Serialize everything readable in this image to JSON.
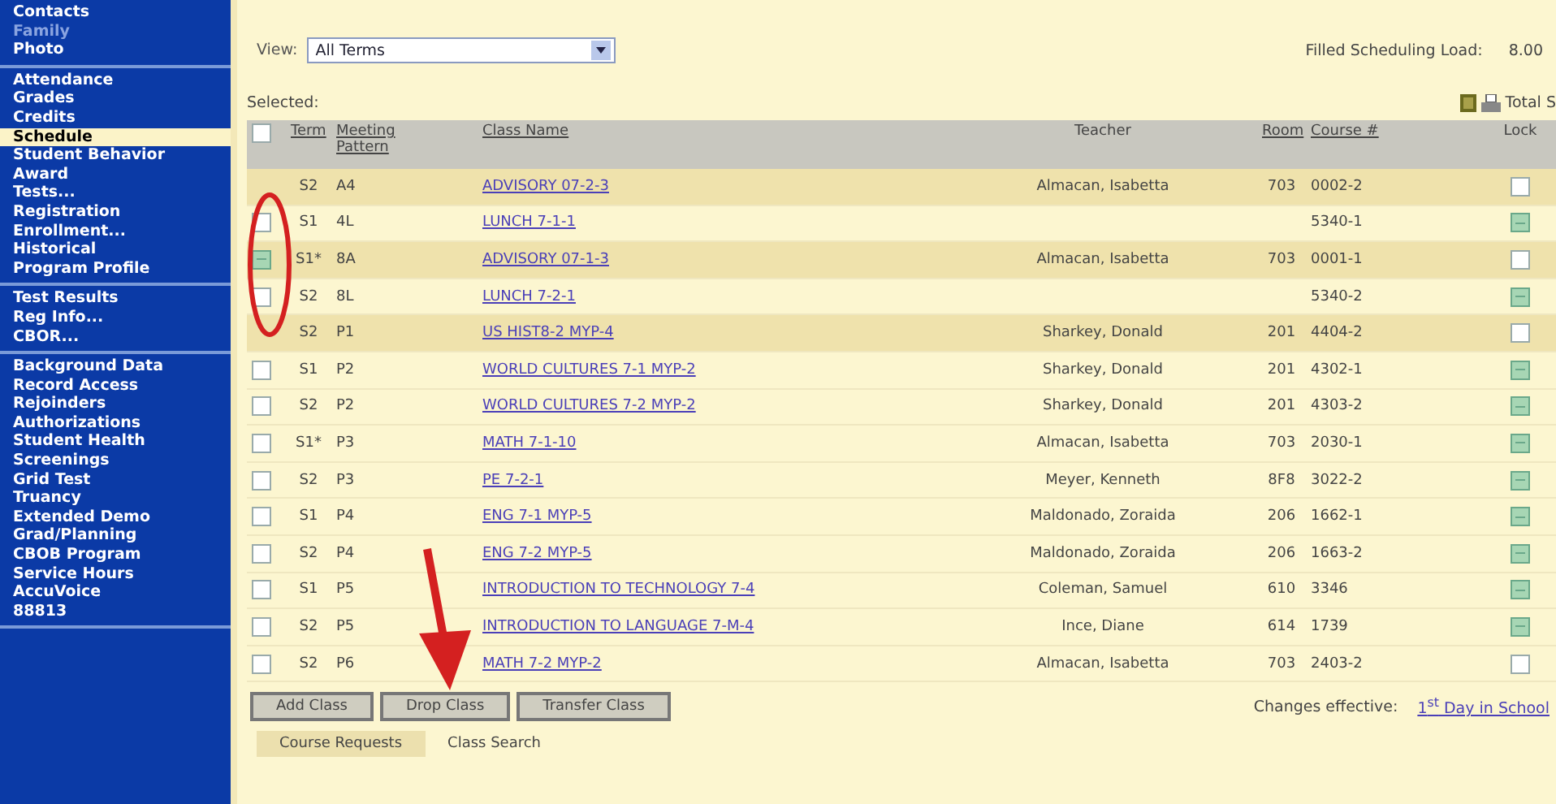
{
  "sidebar": {
    "groups": [
      {
        "items": [
          {
            "label": "Contacts",
            "selected": false,
            "disabled": false
          },
          {
            "label": "Family",
            "selected": false,
            "disabled": true
          },
          {
            "label": "Photo",
            "selected": false,
            "disabled": false
          }
        ]
      },
      {
        "items": [
          {
            "label": "Attendance",
            "selected": false,
            "disabled": false
          },
          {
            "label": "Grades",
            "selected": false,
            "disabled": false
          },
          {
            "label": "Credits",
            "selected": false,
            "disabled": false
          },
          {
            "label": "Schedule",
            "selected": true,
            "disabled": false
          },
          {
            "label": "Student Behavior",
            "selected": false,
            "disabled": false
          },
          {
            "label": "Award",
            "selected": false,
            "disabled": false
          },
          {
            "label": "Tests...",
            "selected": false,
            "disabled": false
          },
          {
            "label": "Registration",
            "selected": false,
            "disabled": false
          },
          {
            "label": "Enrollment...",
            "selected": false,
            "disabled": false
          },
          {
            "label": "Historical",
            "selected": false,
            "disabled": false
          },
          {
            "label": "Program Profile",
            "selected": false,
            "disabled": false
          }
        ]
      },
      {
        "items": [
          {
            "label": "Test Results",
            "selected": false,
            "disabled": false
          },
          {
            "label": "Reg Info...",
            "selected": false,
            "disabled": false
          },
          {
            "label": "CBOR...",
            "selected": false,
            "disabled": false
          }
        ]
      },
      {
        "items": [
          {
            "label": "Background Data",
            "selected": false,
            "disabled": false
          },
          {
            "label": "Record Access",
            "selected": false,
            "disabled": false
          },
          {
            "label": "Rejoinders",
            "selected": false,
            "disabled": false
          },
          {
            "label": "Authorizations",
            "selected": false,
            "disabled": false
          },
          {
            "label": "Student Health",
            "selected": false,
            "disabled": false
          },
          {
            "label": "Screenings",
            "selected": false,
            "disabled": false
          },
          {
            "label": "Grid Test",
            "selected": false,
            "disabled": false
          },
          {
            "label": "Truancy",
            "selected": false,
            "disabled": false
          },
          {
            "label": "Extended Demo",
            "selected": false,
            "disabled": false
          },
          {
            "label": "Grad/Planning",
            "selected": false,
            "disabled": false
          },
          {
            "label": "CBOB Program",
            "selected": false,
            "disabled": false
          },
          {
            "label": "Service Hours",
            "selected": false,
            "disabled": false
          },
          {
            "label": "AccuVoice",
            "selected": false,
            "disabled": false
          },
          {
            "label": "88813",
            "selected": false,
            "disabled": false
          }
        ]
      }
    ]
  },
  "view": {
    "label": "View:",
    "value": "All Terms"
  },
  "load": {
    "label": "Filled Scheduling Load:",
    "value": "8.00"
  },
  "selected_label": "Selected:",
  "total_label": "Total S",
  "table": {
    "columns": [
      "Term",
      "Meeting Pattern",
      "Class Name",
      "Teacher",
      "Room",
      "Course #",
      "Lock"
    ],
    "select_all_checked": false,
    "rows": [
      {
        "term": "S2",
        "pattern": "A4",
        "class_name": "ADVISORY 07-2-3",
        "teacher": "Almacan, Isabetta",
        "room": "703",
        "course": "0002-2",
        "kind": "fixed",
        "locked": false,
        "highlighted": true
      },
      {
        "term": "S1",
        "pattern": "4L",
        "class_name": "LUNCH 7-1-1",
        "teacher": "",
        "room": "",
        "course": "5340-1",
        "kind": "droppable",
        "checked": false,
        "locked": true,
        "highlighted": false
      },
      {
        "term": "S1*",
        "pattern": "8A",
        "class_name": "ADVISORY 07-1-3",
        "teacher": "Almacan, Isabetta",
        "room": "703",
        "course": "0001-1",
        "kind": "droppable",
        "checked": true,
        "locked": false,
        "highlighted": true
      },
      {
        "term": "S2",
        "pattern": "8L",
        "class_name": "LUNCH 7-2-1",
        "teacher": "",
        "room": "",
        "course": "5340-2",
        "kind": "droppable",
        "checked": false,
        "locked": true,
        "highlighted": false
      },
      {
        "term": "S2",
        "pattern": "P1",
        "class_name": "US HIST8-2 MYP-4",
        "teacher": "Sharkey, Donald",
        "room": "201",
        "course": "4404-2",
        "kind": "fixed",
        "locked": false,
        "highlighted": true
      },
      {
        "term": "S1",
        "pattern": "P2",
        "class_name": "WORLD CULTURES 7-1 MYP-2",
        "teacher": "Sharkey, Donald",
        "room": "201",
        "course": "4302-1",
        "kind": "droppable",
        "checked": false,
        "locked": true,
        "highlighted": false
      },
      {
        "term": "S2",
        "pattern": "P2",
        "class_name": "WORLD CULTURES 7-2 MYP-2",
        "teacher": "Sharkey, Donald",
        "room": "201",
        "course": "4303-2",
        "kind": "droppable",
        "checked": false,
        "locked": true,
        "highlighted": false
      },
      {
        "term": "S1*",
        "pattern": "P3",
        "class_name": "MATH 7-1-10",
        "teacher": "Almacan, Isabetta",
        "room": "703",
        "course": "2030-1",
        "kind": "droppable",
        "checked": false,
        "locked": true,
        "highlighted": false
      },
      {
        "term": "S2",
        "pattern": "P3",
        "class_name": "PE 7-2-1",
        "teacher": "Meyer, Kenneth",
        "room": "8F8",
        "course": "3022-2",
        "kind": "droppable",
        "checked": false,
        "locked": true,
        "highlighted": false
      },
      {
        "term": "S1",
        "pattern": "P4",
        "class_name": "ENG 7-1 MYP-5",
        "teacher": "Maldonado, Zoraida",
        "room": "206",
        "course": "1662-1",
        "kind": "droppable",
        "checked": false,
        "locked": true,
        "highlighted": false
      },
      {
        "term": "S2",
        "pattern": "P4",
        "class_name": "ENG 7-2 MYP-5",
        "teacher": "Maldonado, Zoraida",
        "room": "206",
        "course": "1663-2",
        "kind": "droppable",
        "checked": false,
        "locked": true,
        "highlighted": false
      },
      {
        "term": "S1",
        "pattern": "P5",
        "class_name": "INTRODUCTION TO TECHNOLOGY 7-4",
        "teacher": "Coleman, Samuel",
        "room": "610",
        "course": "3346",
        "kind": "droppable",
        "checked": false,
        "locked": true,
        "highlighted": false
      },
      {
        "term": "S2",
        "pattern": "P5",
        "class_name": "INTRODUCTION TO LANGUAGE 7-M-4",
        "teacher": "Ince, Diane",
        "room": "614",
        "course": "1739",
        "kind": "droppable",
        "checked": false,
        "locked": true,
        "highlighted": false
      },
      {
        "term": "S2",
        "pattern": "P6",
        "class_name": "MATH 7-2 MYP-2",
        "teacher": "Almacan, Isabetta",
        "room": "703",
        "course": "2403-2",
        "kind": "droppable",
        "checked": false,
        "locked": false,
        "highlighted": false
      }
    ]
  },
  "buttons": [
    "Add Class",
    "Drop Class",
    "Transfer Class"
  ],
  "changes": {
    "label": "Changes effective:",
    "link": "1$^{st}$ Day in School"
  },
  "tabs": [
    {
      "label": "Course Requests",
      "selected": true
    },
    {
      "label": "Class Search",
      "selected": false
    }
  ],
  "annotations": {
    "oval": true,
    "arrow": true
  }
}
